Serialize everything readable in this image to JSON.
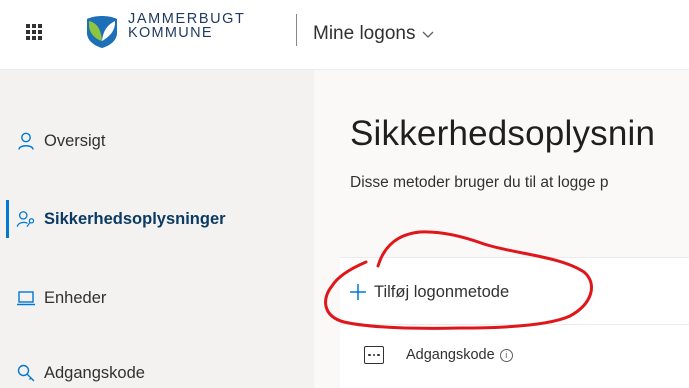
{
  "header": {
    "logo_line1": "JAMMERBUGT",
    "logo_line2": "KOMMUNE",
    "app_title": "Mine logons"
  },
  "sidebar": {
    "items": [
      {
        "label": "Oversigt",
        "icon": "person-icon",
        "active": false
      },
      {
        "label": "Sikkerhedsoplysninger",
        "icon": "person-key-icon",
        "active": true
      },
      {
        "label": "Enheder",
        "icon": "laptop-icon",
        "active": false
      },
      {
        "label": "Adgangskode",
        "icon": "key-icon",
        "active": false
      }
    ]
  },
  "main": {
    "title": "Sikkerhedsoplysnin",
    "description": "Disse metoder bruger du til at logge p",
    "add_method_label": "Tilføj logonmetode",
    "methods": [
      {
        "label": "Adgangskode",
        "icon": "password-icon",
        "info": "i"
      }
    ]
  },
  "colors": {
    "accent": "#0078d4",
    "sidebar_bg": "#f3f2f1",
    "active_text": "#0b3a63",
    "annotation": "#e0161b",
    "logo_green": "#8dc63f",
    "logo_blue": "#1d6fb8"
  }
}
